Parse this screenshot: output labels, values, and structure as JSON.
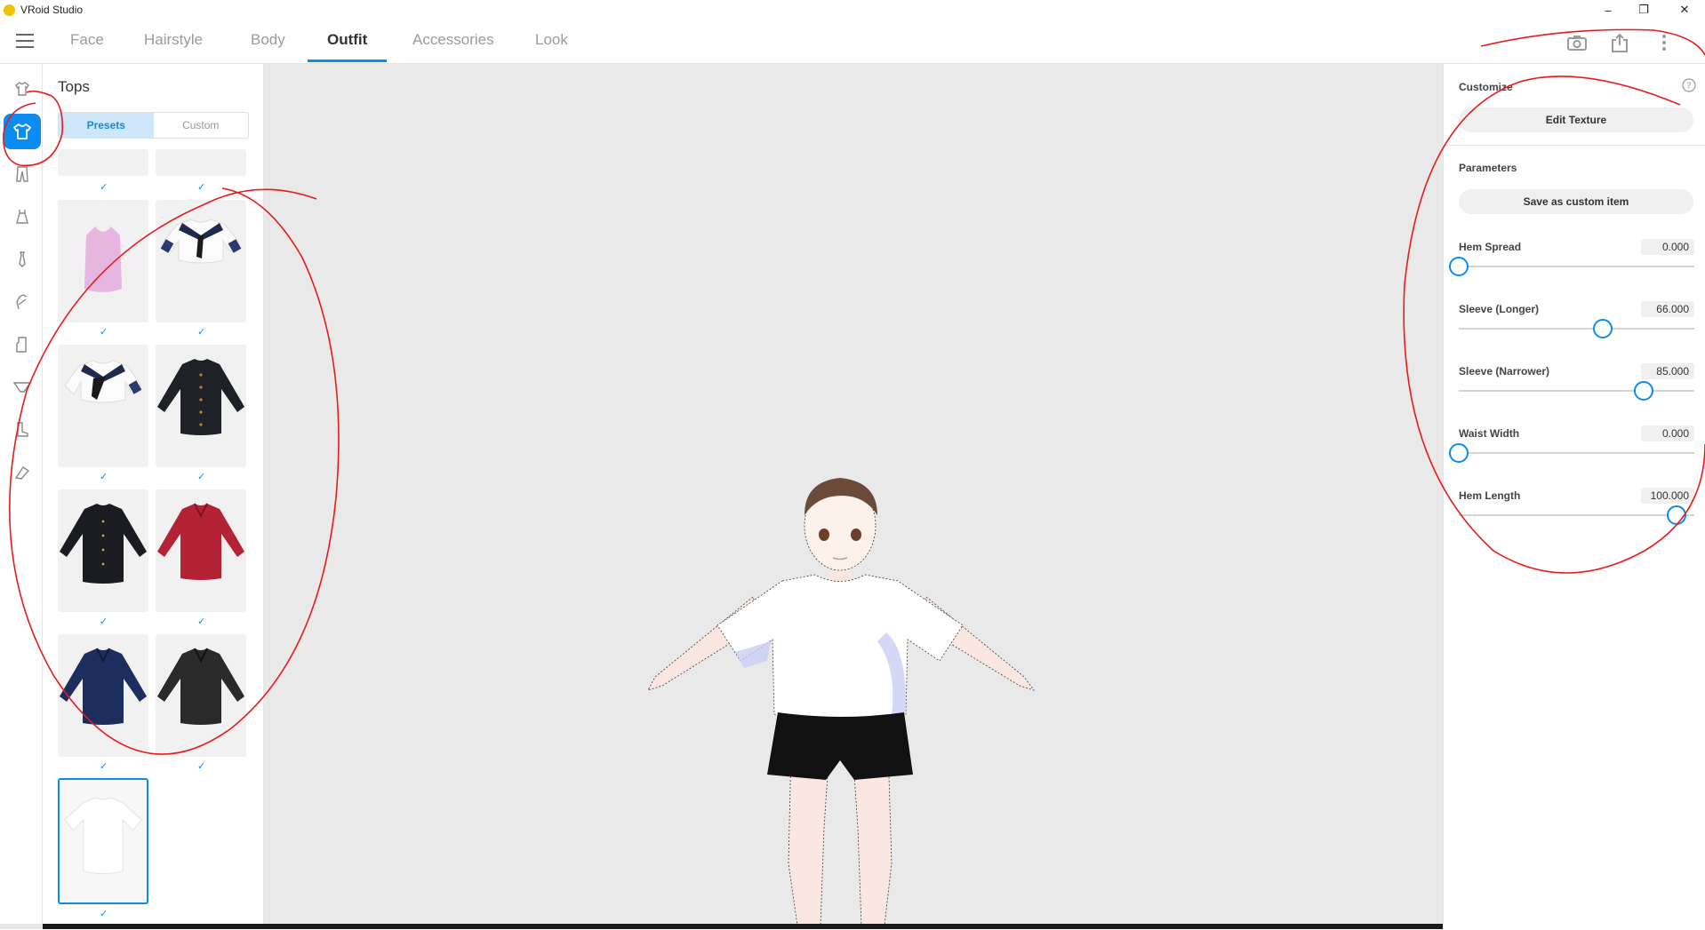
{
  "window": {
    "title": "VRoid Studio",
    "minimize": "–",
    "restore": "❐",
    "close": "✕"
  },
  "nav": {
    "tabs": [
      {
        "label": "Face"
      },
      {
        "label": "Hairstyle"
      },
      {
        "label": "Body"
      },
      {
        "label": "Outfit"
      },
      {
        "label": "Accessories"
      },
      {
        "label": "Look"
      }
    ],
    "active_tab": "Outfit",
    "right_icons": [
      "camera-icon",
      "export-icon",
      "more-vert-icon"
    ]
  },
  "rail": {
    "items": [
      "shirt-outline-icon",
      "shirt-icon",
      "pants-icon",
      "dress-icon",
      "tie-icon",
      "glove-icon",
      "socks-icon",
      "underwear-icon",
      "shoe-icon",
      "accessory-icon"
    ],
    "active": "shirt-icon"
  },
  "panel": {
    "title": "Tops",
    "segments": {
      "presets": "Presets",
      "custom": "Custom"
    },
    "active_segment": "Presets",
    "check_glyph": "✓",
    "items": [
      {
        "name": "partial-top-1",
        "color": "#f1f1f1"
      },
      {
        "name": "partial-top-2",
        "color": "#f1f1f1"
      },
      {
        "name": "pink-vest-top",
        "color": "#e8b9e4"
      },
      {
        "name": "sailor-short-sleeve-top",
        "color": "#ffffff"
      },
      {
        "name": "sailor-tie-top",
        "color": "#ffffff"
      },
      {
        "name": "black-gakuran-jacket",
        "color": "#1e2127"
      },
      {
        "name": "black-gakuran-jacket-2",
        "color": "#1a1c21"
      },
      {
        "name": "red-jacket",
        "color": "#b42236"
      },
      {
        "name": "navy-jacket",
        "color": "#1c2e5e"
      },
      {
        "name": "dark-gray-jacket",
        "color": "#2a2a2a"
      },
      {
        "name": "white-tshirt",
        "color": "#ffffff"
      }
    ],
    "selected_item": "white-tshirt"
  },
  "customize": {
    "title": "Customize",
    "edit_texture": "Edit Texture",
    "params_title": "Parameters",
    "save_custom": "Save as custom item",
    "params": [
      {
        "name": "Hem Spread",
        "value": "0.000",
        "fraction": 0.0
      },
      {
        "name": "Sleeve (Longer)",
        "value": "66.000",
        "fraction": 0.66
      },
      {
        "name": "Sleeve (Narrower)",
        "value": "85.000",
        "fraction": 0.85
      },
      {
        "name": "Waist Width",
        "value": "0.000",
        "fraction": 0.0
      },
      {
        "name": "Hem Length",
        "value": "100.000",
        "fraction": 1.0
      }
    ]
  },
  "colors": {
    "accent": "#0a8cf0",
    "annotation": "#e81b1b",
    "viewport_bg": "#e9e9e9"
  }
}
